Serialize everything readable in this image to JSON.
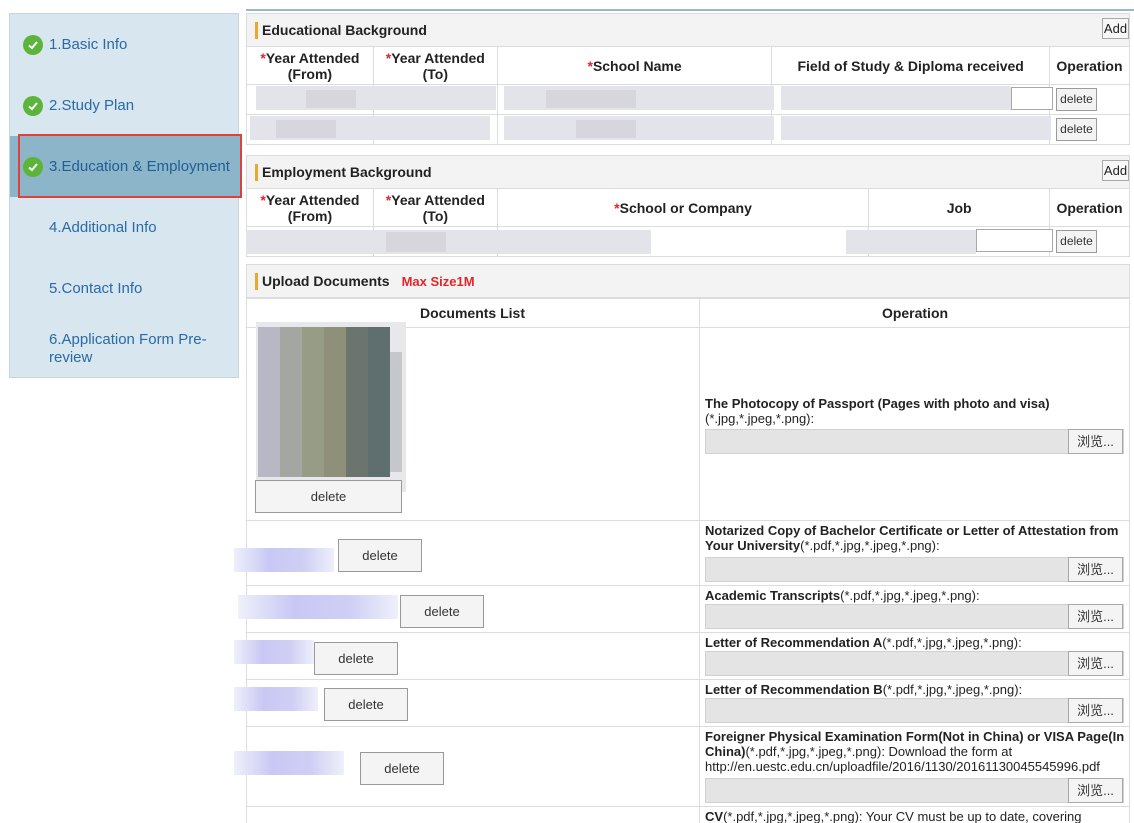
{
  "sidebar": {
    "items": [
      {
        "label": "1.Basic Info",
        "done": true
      },
      {
        "label": "2.Study Plan",
        "done": true
      },
      {
        "label": "3.Education & Employment",
        "done": true,
        "active": true
      },
      {
        "label": "4.Additional Info",
        "done": false
      },
      {
        "label": "5.Contact Info",
        "done": false
      },
      {
        "label": "6.Application Form Pre-review",
        "done": false
      }
    ]
  },
  "education": {
    "title": "Educational Background",
    "add_label": "Add",
    "columns": {
      "year_from": "Year Attended\n(From)",
      "year_to": "Year Attended\n(To)",
      "school": "School Name",
      "field": "Field of Study & Diploma received",
      "operation": "Operation"
    },
    "rows": [
      {
        "delete_label": "delete"
      },
      {
        "delete_label": "delete"
      }
    ]
  },
  "employment": {
    "title": "Employment Background",
    "add_label": "Add",
    "columns": {
      "year_from": "Year Attended\n(From)",
      "year_to": "Year Attended\n(To)",
      "school": "School or Company",
      "job": "Job",
      "operation": "Operation"
    },
    "rows": [
      {
        "delete_label": "delete"
      }
    ]
  },
  "upload": {
    "title": "Upload Documents",
    "max_size": "Max Size1M",
    "col_docs": "Documents List",
    "col_op": "Operation",
    "browse_label": "浏览...",
    "docs": [
      {
        "name_bold": "The Photocopy of Passport (Pages with photo and visa)",
        "suffix": "(*.jpg,*.jpeg,*.png):",
        "delete_label": "delete"
      },
      {
        "name_bold": "Notarized Copy of Bachelor Certificate or Letter of Attestation from Your University",
        "suffix": "(*.pdf,*.jpg,*.jpeg,*.png):",
        "delete_label": "delete"
      },
      {
        "name_bold": "Academic Transcripts",
        "suffix": "(*.pdf,*.jpg,*.jpeg,*.png):",
        "delete_label": "delete"
      },
      {
        "name_bold": "Letter of Recommendation A",
        "suffix": "(*.pdf,*.jpg,*.jpeg,*.png):",
        "delete_label": "delete"
      },
      {
        "name_bold": "Letter of Recommendation B",
        "suffix": "(*.pdf,*.jpg,*.jpeg,*.png):",
        "delete_label": "delete"
      },
      {
        "name_bold": "Foreigner Physical Examination Form(Not in China) or VISA Page(In China)",
        "suffix": "(*.pdf,*.jpg,*.jpeg,*.png):   Download the form at http://en.uestc.edu.cn/uploadfile/2016/1130/20161130045545996.pdf",
        "delete_label": "delete"
      },
      {
        "name_bold": "CV",
        "suffix": "(*.pdf,*.jpg,*.jpeg,*.png):  Your CV must be up to date, covering"
      }
    ]
  }
}
